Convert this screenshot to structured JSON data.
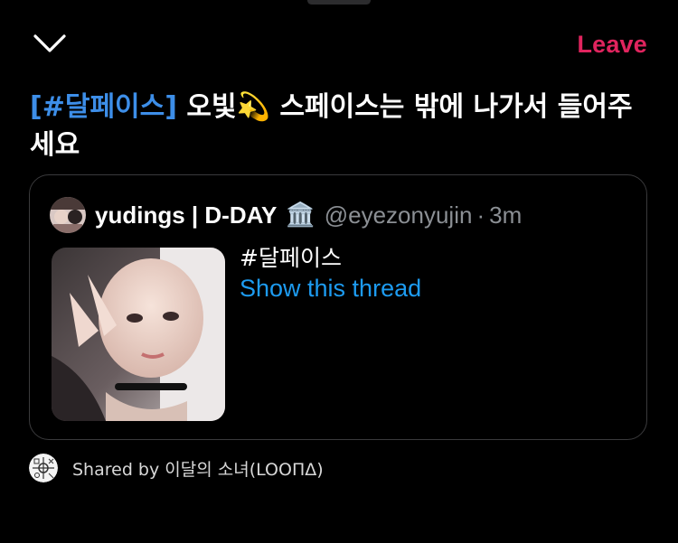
{
  "header": {
    "leave_label": "Leave",
    "collapse_icon": "chevron-down-icon"
  },
  "space": {
    "title_hashtag": "[#달페이스]",
    "title_rest": " 오빛💫 스페이스는 밖에 나가서 들어주세요"
  },
  "tweet": {
    "display_name": "yudings | D-DAY",
    "badge_emoji": "🏛️",
    "handle": "@eyezonyujin",
    "separator": "·",
    "time": "3m",
    "text": "#달페이스",
    "thread_link": "Show this thread"
  },
  "shared": {
    "label": "Shared by 이달의 소녀(LOOΠΔ)"
  },
  "colors": {
    "accent_link": "#1d9bf0",
    "leave_red": "#e0245e",
    "hashtag_blue": "#3d8ee8",
    "card_border": "#3a3a3c",
    "muted_text": "#8b8f94"
  }
}
